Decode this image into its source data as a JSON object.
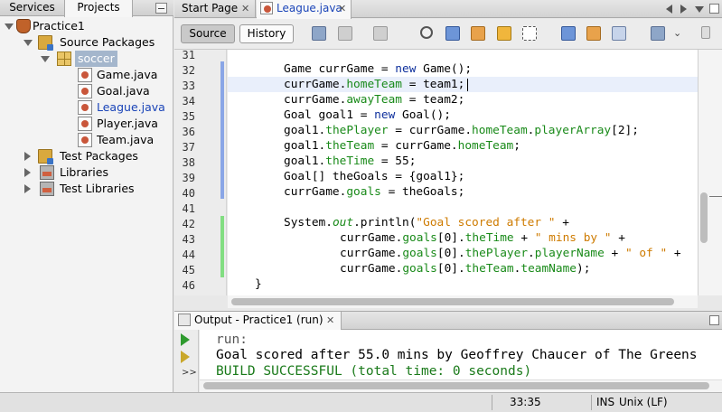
{
  "left_panel": {
    "tabs": [
      "Services",
      "Projects"
    ],
    "tree": [
      {
        "label": "Practice1",
        "icon": "project-cup-icon",
        "level": 0,
        "expanded": true
      },
      {
        "label": "Source Packages",
        "icon": "folder-icon",
        "level": 1,
        "expanded": true
      },
      {
        "label": "soccer",
        "icon": "package-icon",
        "level": 2,
        "expanded": true,
        "selected": true
      },
      {
        "label": "Game.java",
        "icon": "java-file-icon",
        "level": 3
      },
      {
        "label": "Goal.java",
        "icon": "java-file-icon",
        "level": 3
      },
      {
        "label": "League.java",
        "icon": "java-file-icon",
        "level": 3,
        "active": true
      },
      {
        "label": "Player.java",
        "icon": "java-file-icon",
        "level": 3
      },
      {
        "label": "Team.java",
        "icon": "java-file-icon",
        "level": 3
      },
      {
        "label": "Test Packages",
        "icon": "folder-icon",
        "level": 1,
        "expanded": false
      },
      {
        "label": "Libraries",
        "icon": "library-icon",
        "level": 1,
        "expanded": false
      },
      {
        "label": "Test Libraries",
        "icon": "library-icon",
        "level": 1,
        "expanded": false
      }
    ]
  },
  "editor": {
    "tabs": [
      "Start Page",
      "League.java"
    ],
    "active_tab": "League.java",
    "toolbar": {
      "source_label": "Source",
      "history_label": "History"
    },
    "line_numbers": [
      "31",
      "32",
      "33",
      "34",
      "35",
      "36",
      "37",
      "38",
      "39",
      "40",
      "41",
      "42",
      "43",
      "44",
      "45",
      "46"
    ],
    "current_line": "33",
    "caret_column": "33:35"
  },
  "output": {
    "tab_label": "Output - Practice1 (run)",
    "lines": [
      {
        "text": "run:",
        "color": "#555555"
      },
      {
        "text": "Goal scored after 55.0 mins by Geoffrey Chaucer of The Greens",
        "color": "#000000"
      },
      {
        "text": "BUILD SUCCESSFUL (total time: 0 seconds)",
        "color": "#1a7a1a"
      }
    ],
    "more_label": ">>"
  },
  "status_bar": {
    "position": "33:35",
    "insert_mode": "INS",
    "line_endings": "Unix (LF)"
  },
  "colors": {
    "keyword": "#0d2f9c",
    "field": "#198a19",
    "string": "#ce7b00",
    "active_tab_text": "#1a44b8"
  }
}
